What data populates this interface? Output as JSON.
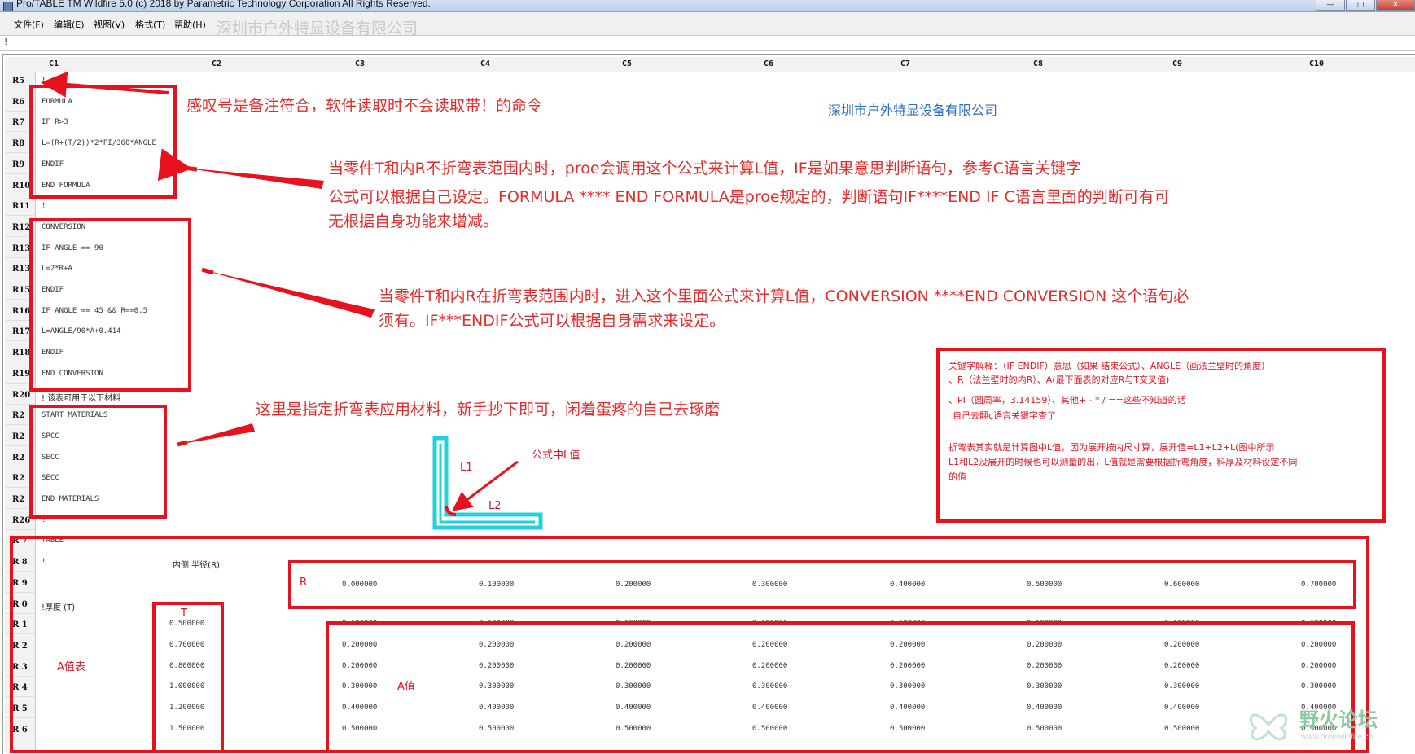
{
  "window": {
    "title": "Pro/TABLE  TM  Wildfire 5.0  (c) 2018 by Parametric Technology Corporation  All Rights Reserved.",
    "controls": [
      "—",
      "▢",
      "✕"
    ]
  },
  "menu": [
    "文件(F)",
    "编辑(E)",
    "视图(V)",
    "格式(T)",
    "帮助(H)"
  ],
  "watermark_top": "深圳市户外特显设备有限公司",
  "input_caret": "!",
  "columns": [
    "C1",
    "C2",
    "C3",
    "C4",
    "C5",
    "C6",
    "C7",
    "C8",
    "C9",
    "C10"
  ],
  "rows": [
    "R5",
    "R6",
    "R7",
    "R8",
    "R9",
    "R10",
    "R11",
    "R12",
    "R13",
    "R14",
    "R15",
    "R16",
    "R17",
    "R18",
    "R19",
    "R20",
    "R21",
    "R22",
    "R23",
    "R24",
    "R25",
    "R26",
    "R27",
    "R28",
    "R29",
    "R30",
    "R31",
    "R32",
    "R33",
    "R34",
    "R35",
    "R36"
  ],
  "row_labels_shown": [
    "R5",
    "R6",
    "R7",
    "R8",
    "R9",
    "R10",
    "R11",
    "R12",
    "R13",
    "R13",
    "R15",
    "R16",
    "R17",
    "R18",
    "R19",
    "R20",
    "R2",
    "R2",
    "R2",
    "R2",
    "R2",
    "R26",
    "R 7",
    "R 8",
    "R 9",
    "R 0",
    "R 1",
    "R 2",
    "R 3",
    "R 4",
    "R 5",
    "R 6"
  ],
  "c1_cells": [
    "!",
    "FORMULA",
    "IF R>3",
    "L=(R+(T/2))*2*PI/360*ANGLE",
    "ENDIF",
    "END FORMULA",
    "!",
    "CONVERSION",
    "IF ANGLE == 90",
    "L=2*R+A",
    "ENDIF",
    "IF  ANGLE == 45  &&  R==0.5",
    "L=ANGLE/90*A+0.414",
    "ENDIF",
    "END CONVERSION",
    "! 该表可用于以下材料",
    "START MATERIALS",
    "SPCC",
    "SECC",
    "SECC",
    "END MATERIALS",
    "!",
    "TABLE",
    "!",
    "",
    "!厚度  (T)"
  ],
  "r28_c2": "内侧  半径(R)",
  "r_values": [
    "0.000000",
    "0.100000",
    "0.200000",
    "0.300000",
    "0.400000",
    "0.500000",
    "0.600000",
    "0.700000"
  ],
  "t_values": [
    "0.500000",
    "0.700000",
    "0.800000",
    "1.000000",
    "1.200000",
    "1.500000"
  ],
  "a_rows": [
    [
      "0.100000",
      "0.100000",
      "0.100000",
      "0.100000",
      "0.100000",
      "0.100000",
      "0.100000",
      "0.100000"
    ],
    [
      "0.200000",
      "0.200000",
      "0.200000",
      "0.200000",
      "0.200000",
      "0.200000",
      "0.200000",
      "0.200000"
    ],
    [
      "0.200000",
      "0.200000",
      "0.200000",
      "0.200000",
      "0.200000",
      "0.200000",
      "0.200000",
      "0.200000"
    ],
    [
      "0.300000",
      "0.300000",
      "0.300000",
      "0.300000",
      "0.300000",
      "0.300000",
      "0.300000",
      "0.300000"
    ],
    [
      "0.400000",
      "0.400000",
      "0.400000",
      "0.400000",
      "0.400000",
      "0.400000",
      "0.400000",
      "0.400000"
    ],
    [
      "0.500000",
      "0.500000",
      "0.500000",
      "0.500000",
      "0.500000",
      "0.500000",
      "0.500000",
      "0.500000"
    ]
  ],
  "annotations": {
    "a1": "感叹号是备注符合，软件读取时不会读取带！的命令",
    "blue": "深圳市户外特显设备有限公司",
    "a2_l1": "当零件T和内R不折弯表范围内时，proe会调用这个公式来计算L值，IF是如果意思判断语句，参考C语言关键字",
    "a2_l2": "公式可以根据自己设定。FORMULA ****  END FORMULA是proe规定的，判断语句IF****END IF C语言里面的判断可有可",
    "a2_l3": "无根据自身功能来增减。",
    "a3_l1": "当零件T和内R在折弯表范围内时，进入这个里面公式来计算L值，CONVERSION ****END CONVERSION 这个语句必",
    "a3_l2": "须有。IF***ENDIF公式可以根据自身需求来设定。",
    "a4": "这里是指定折弯表应用材料，新手抄下即可，闲着蛋疼的自己去琢磨",
    "l_value": "公式中L值",
    "l1": "L1",
    "l2": "L2",
    "r_label": "R",
    "t_label": "T",
    "a_table": "A值表",
    "a_value": "A值"
  },
  "note_box": [
    "关键字解释：（IF ENDIF）意思（如果 结束公式）、ANGLE（画法兰壁时的角度）",
    "、R（法兰壁时的内R）、A(最下面表的对应R与T交叉值)",
    "、PI（圆周率，3.14159）、其他+ - * / ==这些不知道的话",
    "自己去翻c语言关键字查了",
    "",
    "折弯表其实就是计算图中L值，因为展开按内尺寸算，展开值=L1+L2+L(图中所示",
    "L1和L2没展开的时候也可以测量的出，L值就是需要根据折弯角度，料厚及材料设定不同",
    "的值"
  ],
  "logo": {
    "text": "野火论坛",
    "sub": "www.proewildfire.cn"
  },
  "colors": {
    "annotation_red": "#e8121f",
    "blue_text": "#2f6fc5",
    "cyan_part": "#1fd3d8"
  }
}
